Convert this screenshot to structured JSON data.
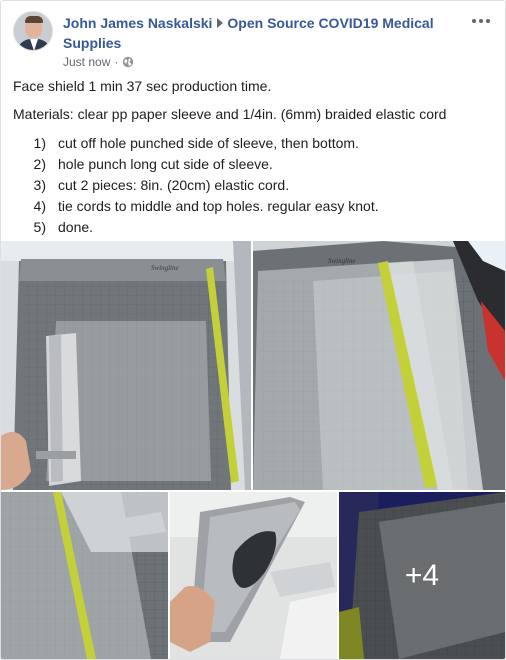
{
  "post": {
    "author": "John James Naskalski",
    "group": "Open Source COVID19 Medical Supplies",
    "timestamp": "Just now",
    "privacy_icon": "globe-icon",
    "more_icon": "more-options-icon",
    "text": {
      "line1": "Face shield 1 min 37 sec production time.",
      "line2": "Materials: clear pp paper sleeve and 1/4in. (6mm) braided elastic cord",
      "steps": [
        {
          "num": "1)",
          "text": "cut off hole punched side of sleeve, then bottom."
        },
        {
          "num": "2)",
          "text": "hole punch long cut side of sleeve."
        },
        {
          "num": "3)",
          "text": "cut 2 pieces:  8in. (20cm) elastic cord."
        },
        {
          "num": "4)",
          "text": "tie cords to middle and top holes. regular easy knot."
        },
        {
          "num": "5)",
          "text": "done."
        }
      ]
    },
    "photos": {
      "more_count": "+4"
    }
  },
  "colors": {
    "link": "#385898",
    "meta": "#616770",
    "cutter_blade": "#c4d03a"
  }
}
